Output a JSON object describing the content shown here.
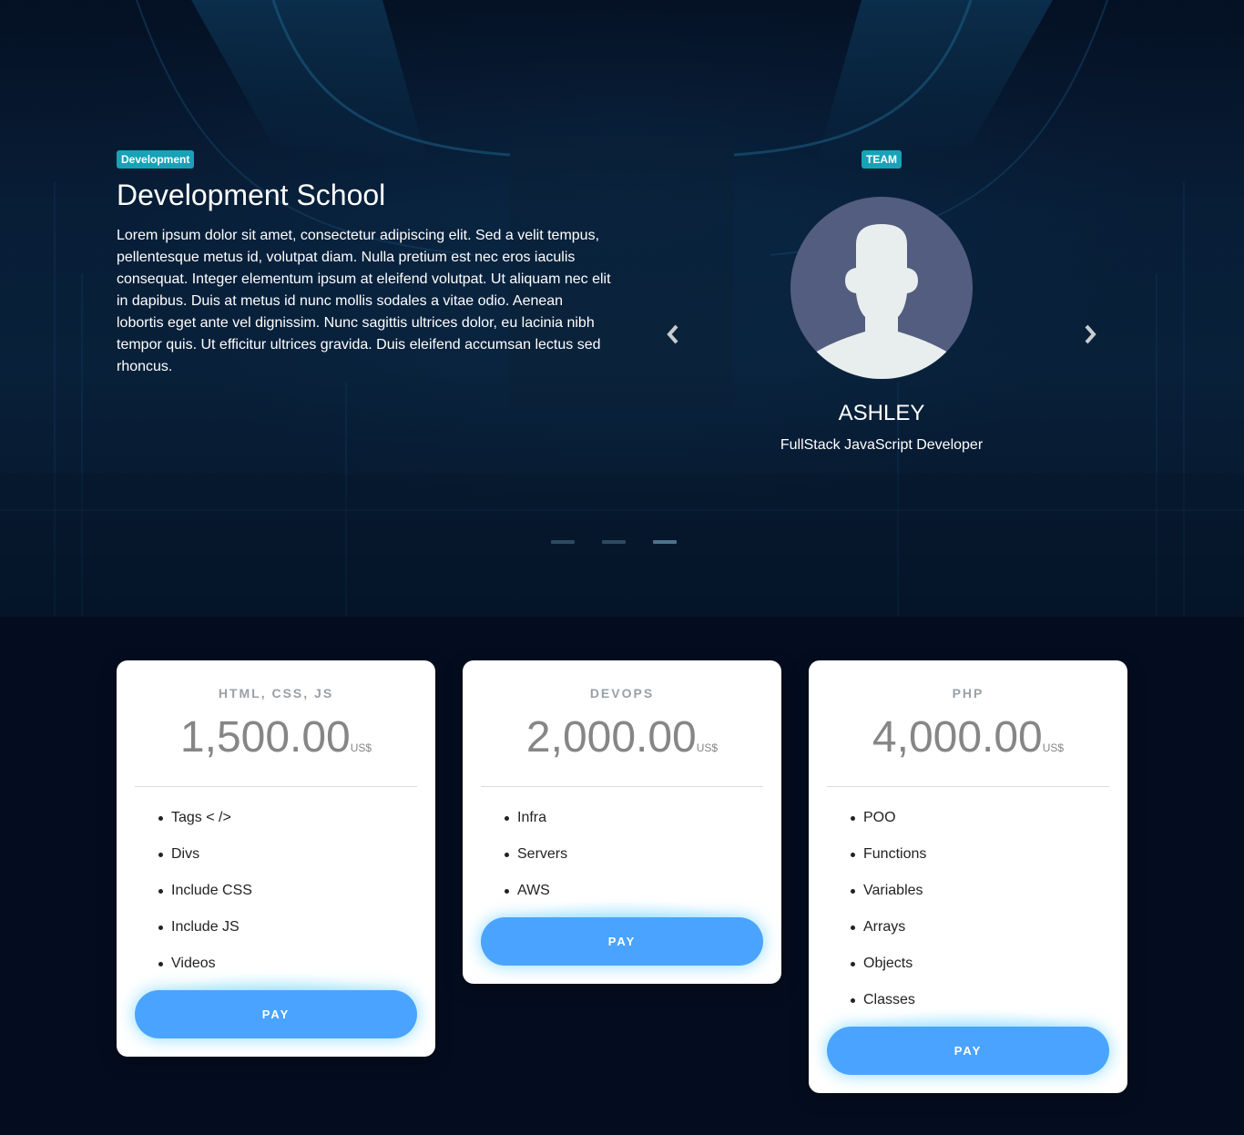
{
  "hero": {
    "category_badge": "Development",
    "title": "Development School",
    "description": "Lorem ipsum dolor sit amet, consectetur adipiscing elit. Sed a velit tempus, pellentesque metus id, volutpat diam. Nulla pretium est nec eros iaculis consequat. Integer elementum ipsum at eleifend volutpat. Ut aliquam nec elit in dapibus. Duis at metus id nunc mollis sodales a vitae odio. Aenean lobortis eget ante vel dignissim. Nunc sagittis ultrices dolor, eu lacinia nibh tempor quis. Ut efficitur ultrices gravida. Duis eleifend accumsan lectus sed rhoncus."
  },
  "team": {
    "badge": "TEAM",
    "member": {
      "name": "ASHLEY",
      "role": "FullStack JavaScript Developer",
      "avatar_icon": "user-silhouette-icon"
    },
    "prev_icon": "chevron-left-icon",
    "next_icon": "chevron-right-icon",
    "indicator_count": 3,
    "active_indicator": 2
  },
  "colors": {
    "badge": "#17a2b8",
    "pay_button": "#4aa4ff",
    "avatar_bg": "#525d7f",
    "page_bg": "#040d1f"
  },
  "pricing": [
    {
      "title": "HTML, CSS, JS",
      "price": "1,500.00",
      "currency": "US$",
      "features": [
        "Tags < />",
        "Divs",
        "Include CSS",
        "Include JS",
        "Videos"
      ],
      "button": "PAY"
    },
    {
      "title": "DEVOPS",
      "price": "2,000.00",
      "currency": "US$",
      "features": [
        "Infra",
        "Servers",
        "AWS"
      ],
      "button": "PAY"
    },
    {
      "title": "PHP",
      "price": "4,000.00",
      "currency": "US$",
      "features": [
        "POO",
        "Functions",
        "Variables",
        "Arrays",
        "Objects",
        "Classes"
      ],
      "button": "PAY"
    }
  ]
}
